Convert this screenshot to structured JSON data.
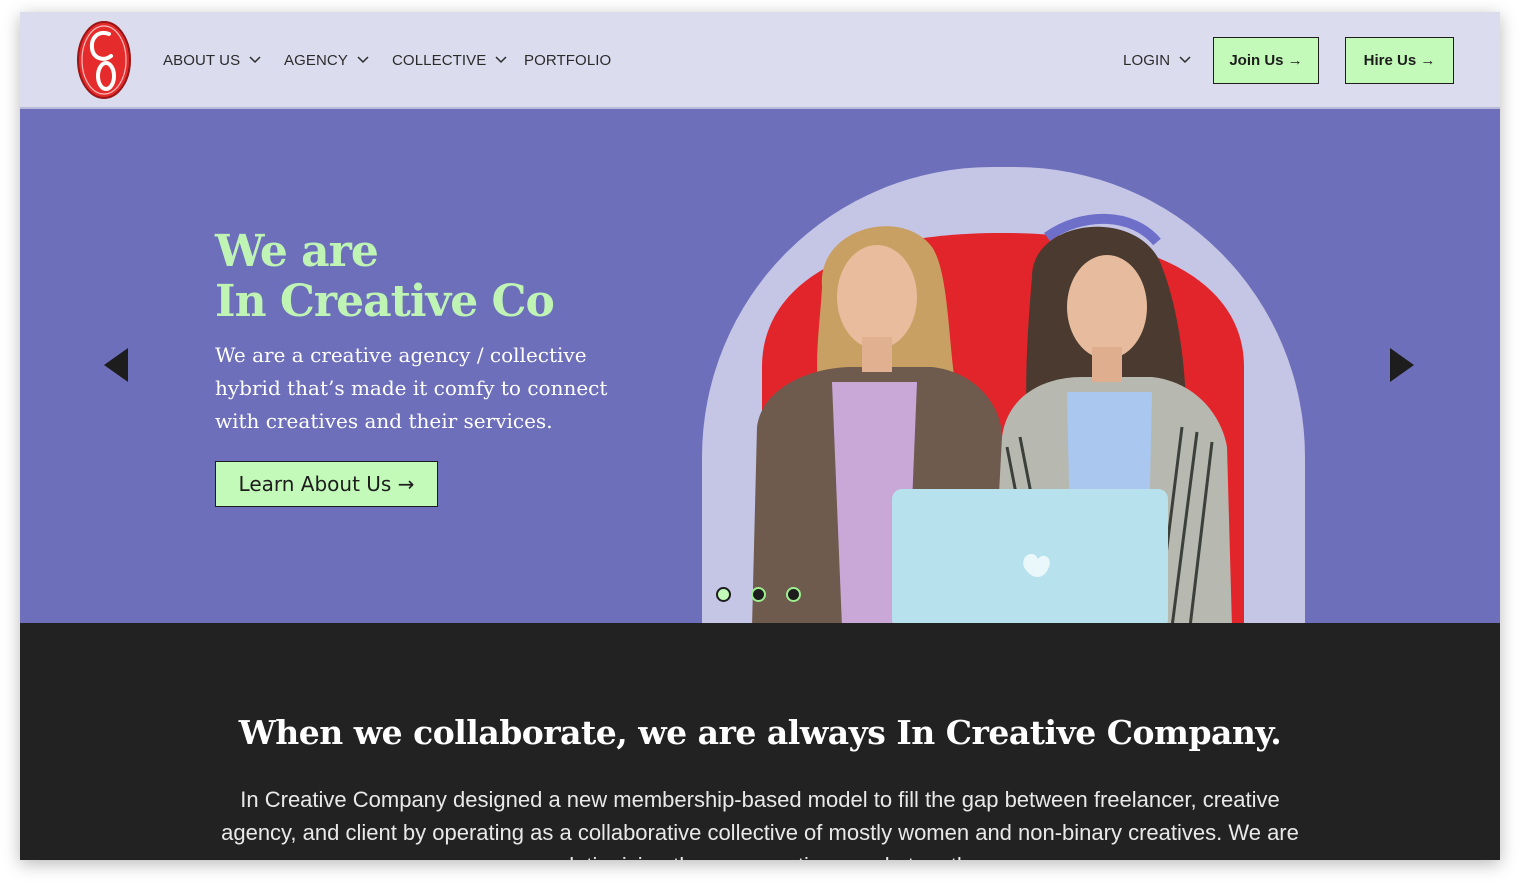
{
  "nav": {
    "logo_text": "CO",
    "items": [
      {
        "label": "ABOUT US",
        "has_dropdown": true
      },
      {
        "label": "AGENCY",
        "has_dropdown": true
      },
      {
        "label": "COLLECTIVE",
        "has_dropdown": true
      },
      {
        "label": "PORTFOLIO",
        "has_dropdown": false
      }
    ],
    "login": {
      "label": "LOGIN",
      "has_dropdown": true
    },
    "join_label": "Join Us →",
    "hire_label": "Hire Us →"
  },
  "hero": {
    "title_line1": "We are",
    "title_line2": "In Creative Co",
    "description": "We are a creative agency / collective hybrid that’s made it comfy to connect with creatives and their services.",
    "button_label": "Learn About Us →",
    "prev_icon": "caret-left-icon",
    "next_icon": "caret-right-icon",
    "slides": 3,
    "active_slide": 1
  },
  "about": {
    "heading": "When we collaborate, we are always In Creative Company.",
    "body": "In Creative Company designed a new membership-based model to fill the gap between freelancer, creative agency, and client by operating as a collaborative collective of mostly women and non-binary creatives. We are revolutionizing the way creatives work, together."
  },
  "colors": {
    "nav_bg": "#dcdcef",
    "hero_bg": "#6d6fbb",
    "accent_green": "#c3fab9",
    "title_green": "#bff4b5",
    "logo_red": "#e52b2b",
    "dark_bg": "#222222"
  }
}
